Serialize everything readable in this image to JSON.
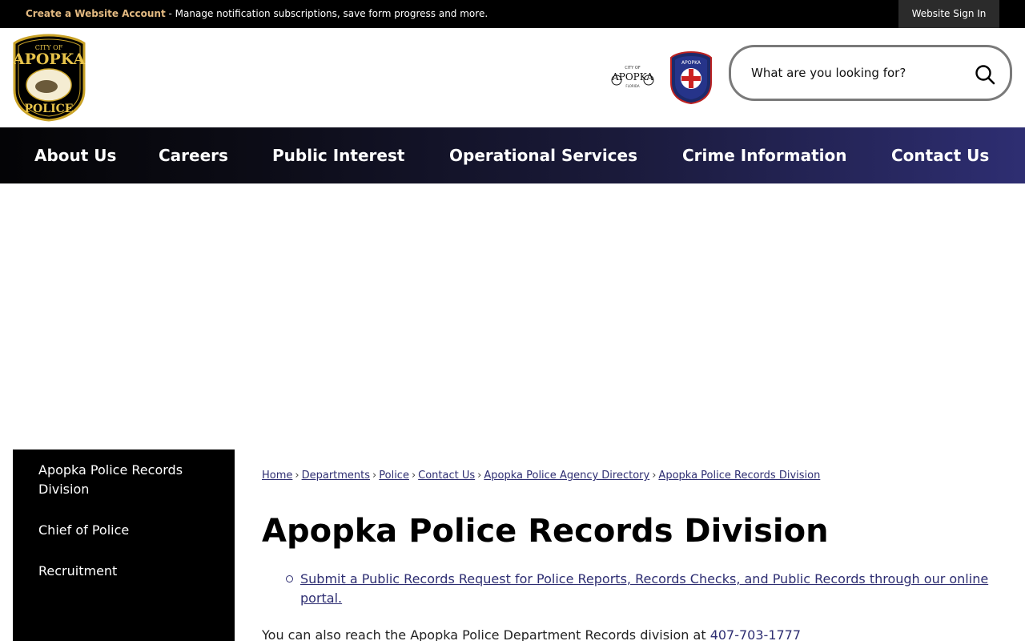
{
  "topbar": {
    "create_account": "Create a Website Account",
    "message": " - Manage notification subscriptions, save form progress and more.",
    "sign_in": "Website Sign In"
  },
  "header": {
    "logo_alt": "City of Apopka Police",
    "search": {
      "placeholder": "What are you looking for?"
    },
    "icons": [
      "city-of-apopka-logo-icon",
      "apopka-fire-badge-icon",
      "search-icon"
    ]
  },
  "nav": {
    "items": [
      {
        "label": "About Us"
      },
      {
        "label": "Careers"
      },
      {
        "label": "Public Interest"
      },
      {
        "label": "Operational Services"
      },
      {
        "label": "Crime Information"
      },
      {
        "label": "Contact Us"
      }
    ]
  },
  "sidebar": {
    "items": [
      {
        "label": "Apopka Police Records Division"
      },
      {
        "label": "Chief of Police"
      },
      {
        "label": "Recruitment"
      }
    ]
  },
  "breadcrumb": {
    "items": [
      {
        "label": "Home"
      },
      {
        "label": "Departments"
      },
      {
        "label": "Police"
      },
      {
        "label": "Contact Us"
      },
      {
        "label": "Apopka Police Agency Directory"
      },
      {
        "label": "Apopka Police Records Division"
      }
    ]
  },
  "main": {
    "title": "Apopka Police Records Division",
    "link": "Submit a Public Records Request for Police Reports, Records Checks, and Public Records through our online portal. ",
    "para_text": "You can also reach the Apopka Police Department Records division at ",
    "phone": "407-703-1777"
  },
  "colors": {
    "accent": "#2e2e72",
    "topbar": "#000000",
    "account_link": "#e2b981"
  }
}
